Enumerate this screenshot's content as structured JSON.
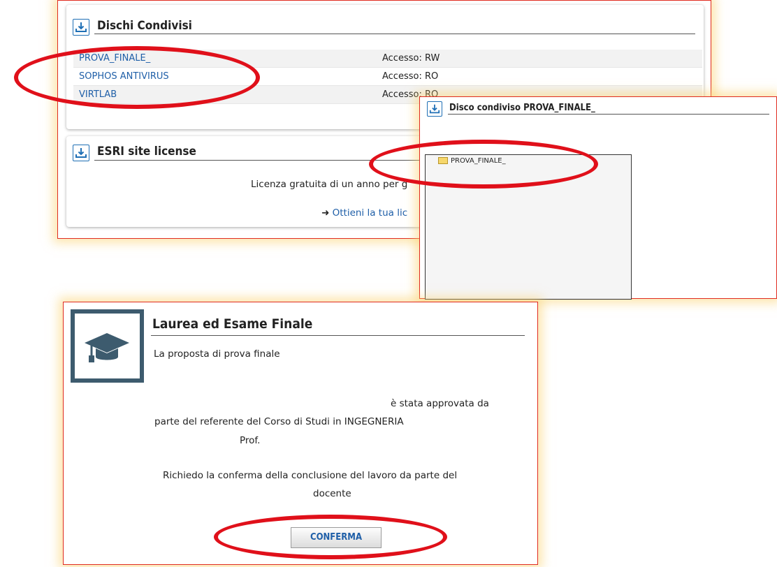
{
  "shared_disks": {
    "title": "Dischi Condivisi",
    "rows": [
      {
        "name": "PROVA_FINALE_",
        "access": "Accesso: RW"
      },
      {
        "name": "SOPHOS ANTIVIRUS",
        "access": "Accesso: RO"
      },
      {
        "name": "VIRTLAB",
        "access": "Accesso: RO"
      }
    ]
  },
  "esri": {
    "title": "ESRI site license",
    "description": "Licenza gratuita di un anno per g",
    "link": "Ottieni la tua lic"
  },
  "disk_popup": {
    "title": "Disco condiviso PROVA_FINALE_",
    "folder": "PROVA_FINALE_"
  },
  "laurea": {
    "title": "Laurea ed Esame Finale",
    "line1": "La proposta di prova finale",
    "line2": "è stata approvata da",
    "line3": "parte del referente del Corso di Studi in INGEGNERIA",
    "line4": "Prof.",
    "request1": "Richiedo la conferma della conclusione del lavoro da parte del",
    "request2": "docente",
    "confirm_label": "CONFERMA"
  },
  "colors": {
    "highlight": "#e0101a",
    "accent": "#1f6fb5",
    "icon_bg": "#3d5b6e"
  }
}
